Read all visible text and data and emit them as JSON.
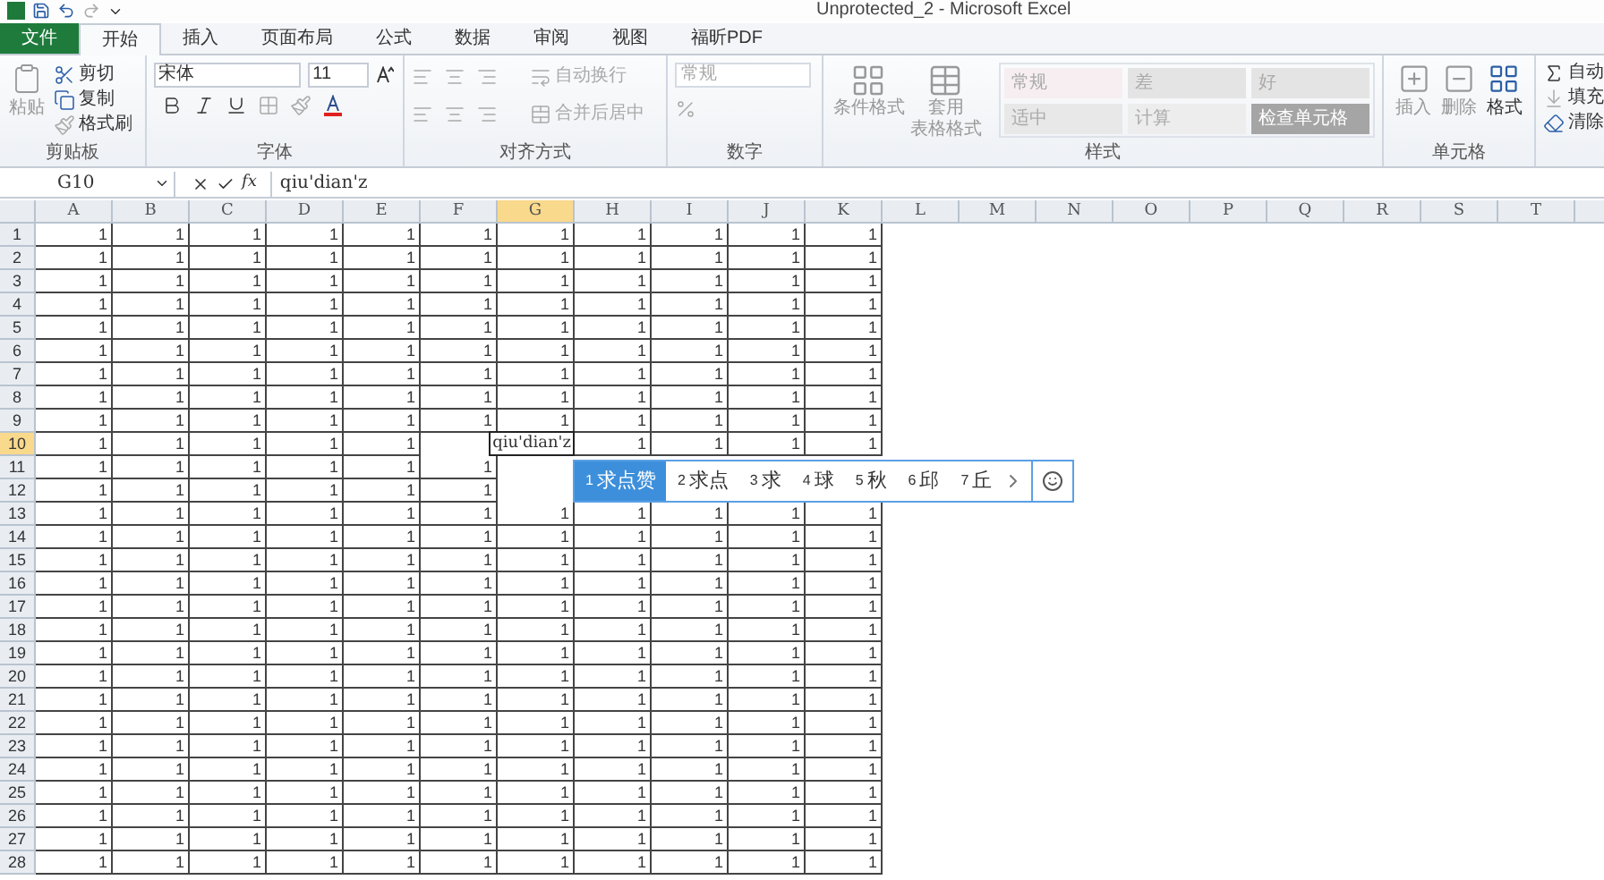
{
  "window": {
    "title": "Unprotected_2 - Microsoft Excel"
  },
  "tabs": [
    {
      "label": "文件",
      "kind": "file",
      "selected": false
    },
    {
      "label": "开始",
      "kind": "tab",
      "selected": true
    },
    {
      "label": "插入",
      "kind": "tab",
      "selected": false
    },
    {
      "label": "页面布局",
      "kind": "tab",
      "selected": false
    },
    {
      "label": "公式",
      "kind": "tab",
      "selected": false
    },
    {
      "label": "数据",
      "kind": "tab",
      "selected": false
    },
    {
      "label": "审阅",
      "kind": "tab",
      "selected": false
    },
    {
      "label": "视图",
      "kind": "tab",
      "selected": false
    },
    {
      "label": "福昕PDF",
      "kind": "tab",
      "selected": false
    }
  ],
  "ribbon": {
    "clipboard": {
      "label": "剪贴板",
      "paste": "粘贴",
      "items": [
        "剪切",
        "复制",
        "格式刷"
      ]
    },
    "font": {
      "label": "字体",
      "font_name": "宋体",
      "font_size": "11"
    },
    "alignment": {
      "label": "对齐方式",
      "wrap": "自动换行",
      "merge": "合并后居中"
    },
    "number": {
      "label": "数字",
      "format": "常规"
    },
    "styles": {
      "label": "样式",
      "buttons": [
        [
          "条件格式"
        ],
        [
          "套用",
          "表格格式"
        ]
      ],
      "cell_styles": [
        {
          "label": "常规",
          "color": "#f6eef0"
        },
        {
          "label": "差",
          "color": "#e4e4e4"
        },
        {
          "label": "好",
          "color": "#e4e4e4"
        },
        {
          "label": "适中",
          "color": "#e8e8e8"
        },
        {
          "label": "计算",
          "color": "#ededed"
        },
        {
          "label": "检查单元格",
          "color": "#a5a5a5"
        }
      ]
    },
    "cells": {
      "label": "单元格",
      "buttons": [
        "插入",
        "删除",
        "格式"
      ]
    },
    "editing": {
      "items": [
        "自动",
        "填充",
        "清除"
      ]
    }
  },
  "formula_bar": {
    "name_box": "G10",
    "function_label": "fx",
    "formula": "qiu'dian'z"
  },
  "sheet": {
    "columns": [
      {
        "label": "A",
        "selected": false
      },
      {
        "label": "B",
        "selected": false
      },
      {
        "label": "C",
        "selected": false
      },
      {
        "label": "D",
        "selected": false
      },
      {
        "label": "E",
        "selected": false
      },
      {
        "label": "F",
        "selected": false
      },
      {
        "label": "G",
        "selected": true
      },
      {
        "label": "H",
        "selected": false
      },
      {
        "label": "I",
        "selected": false
      },
      {
        "label": "J",
        "selected": false
      },
      {
        "label": "K",
        "selected": false
      },
      {
        "label": "L",
        "selected": false
      },
      {
        "label": "M",
        "selected": false
      },
      {
        "label": "N",
        "selected": false
      },
      {
        "label": "O",
        "selected": false
      },
      {
        "label": "P",
        "selected": false
      },
      {
        "label": "Q",
        "selected": false
      },
      {
        "label": "R",
        "selected": false
      },
      {
        "label": "S",
        "selected": false
      },
      {
        "label": "T",
        "selected": false
      }
    ],
    "rows": [
      {
        "label": "1",
        "selected": false,
        "cells": [
          "1",
          "1",
          "1",
          "1",
          "1",
          "1",
          "1",
          "1",
          "1",
          "1",
          "1"
        ]
      },
      {
        "label": "2",
        "selected": false,
        "cells": [
          "1",
          "1",
          "1",
          "1",
          "1",
          "1",
          "1",
          "1",
          "1",
          "1",
          "1"
        ]
      },
      {
        "label": "3",
        "selected": false,
        "cells": [
          "1",
          "1",
          "1",
          "1",
          "1",
          "1",
          "1",
          "1",
          "1",
          "1",
          "1"
        ]
      },
      {
        "label": "4",
        "selected": false,
        "cells": [
          "1",
          "1",
          "1",
          "1",
          "1",
          "1",
          "1",
          "1",
          "1",
          "1",
          "1"
        ]
      },
      {
        "label": "5",
        "selected": false,
        "cells": [
          "1",
          "1",
          "1",
          "1",
          "1",
          "1",
          "1",
          "1",
          "1",
          "1",
          "1"
        ]
      },
      {
        "label": "6",
        "selected": false,
        "cells": [
          "1",
          "1",
          "1",
          "1",
          "1",
          "1",
          "1",
          "1",
          "1",
          "1",
          "1"
        ]
      },
      {
        "label": "7",
        "selected": false,
        "cells": [
          "1",
          "1",
          "1",
          "1",
          "1",
          "1",
          "1",
          "1",
          "1",
          "1",
          "1"
        ]
      },
      {
        "label": "8",
        "selected": false,
        "cells": [
          "1",
          "1",
          "1",
          "1",
          "1",
          "1",
          "1",
          "1",
          "1",
          "1",
          "1"
        ]
      },
      {
        "label": "9",
        "selected": false,
        "cells": [
          "1",
          "1",
          "1",
          "1",
          "1",
          "1",
          "1",
          "1",
          "1",
          "1",
          "1"
        ]
      },
      {
        "label": "10",
        "selected": true,
        "cells": [
          "1",
          "1",
          "1",
          "1",
          "1",
          null,
          "qiu'dian'z",
          "1",
          "1",
          "1",
          "1"
        ]
      },
      {
        "label": "11",
        "selected": false,
        "cells": [
          "1",
          "1",
          "1",
          "1",
          "1",
          "1",
          null,
          null,
          null,
          null,
          null
        ]
      },
      {
        "label": "12",
        "selected": false,
        "cells": [
          "1",
          "1",
          "1",
          "1",
          "1",
          "1",
          null,
          null,
          null,
          null,
          null
        ]
      },
      {
        "label": "13",
        "selected": false,
        "cells": [
          "1",
          "1",
          "1",
          "1",
          "1",
          "1",
          "1",
          "1",
          "1",
          "1",
          "1"
        ]
      },
      {
        "label": "14",
        "selected": false,
        "cells": [
          "1",
          "1",
          "1",
          "1",
          "1",
          "1",
          "1",
          "1",
          "1",
          "1",
          "1"
        ]
      },
      {
        "label": "15",
        "selected": false,
        "cells": [
          "1",
          "1",
          "1",
          "1",
          "1",
          "1",
          "1",
          "1",
          "1",
          "1",
          "1"
        ]
      },
      {
        "label": "16",
        "selected": false,
        "cells": [
          "1",
          "1",
          "1",
          "1",
          "1",
          "1",
          "1",
          "1",
          "1",
          "1",
          "1"
        ]
      },
      {
        "label": "17",
        "selected": false,
        "cells": [
          "1",
          "1",
          "1",
          "1",
          "1",
          "1",
          "1",
          "1",
          "1",
          "1",
          "1"
        ]
      },
      {
        "label": "18",
        "selected": false,
        "cells": [
          "1",
          "1",
          "1",
          "1",
          "1",
          "1",
          "1",
          "1",
          "1",
          "1",
          "1"
        ]
      },
      {
        "label": "19",
        "selected": false,
        "cells": [
          "1",
          "1",
          "1",
          "1",
          "1",
          "1",
          "1",
          "1",
          "1",
          "1",
          "1"
        ]
      },
      {
        "label": "20",
        "selected": false,
        "cells": [
          "1",
          "1",
          "1",
          "1",
          "1",
          "1",
          "1",
          "1",
          "1",
          "1",
          "1"
        ]
      },
      {
        "label": "21",
        "selected": false,
        "cells": [
          "1",
          "1",
          "1",
          "1",
          "1",
          "1",
          "1",
          "1",
          "1",
          "1",
          "1"
        ]
      },
      {
        "label": "22",
        "selected": false,
        "cells": [
          "1",
          "1",
          "1",
          "1",
          "1",
          "1",
          "1",
          "1",
          "1",
          "1",
          "1"
        ]
      },
      {
        "label": "23",
        "selected": false,
        "cells": [
          "1",
          "1",
          "1",
          "1",
          "1",
          "1",
          "1",
          "1",
          "1",
          "1",
          "1"
        ]
      },
      {
        "label": "24",
        "selected": false,
        "cells": [
          "1",
          "1",
          "1",
          "1",
          "1",
          "1",
          "1",
          "1",
          "1",
          "1",
          "1"
        ]
      },
      {
        "label": "25",
        "selected": false,
        "cells": [
          "1",
          "1",
          "1",
          "1",
          "1",
          "1",
          "1",
          "1",
          "1",
          "1",
          "1"
        ]
      },
      {
        "label": "26",
        "selected": false,
        "cells": [
          "1",
          "1",
          "1",
          "1",
          "1",
          "1",
          "1",
          "1",
          "1",
          "1",
          "1"
        ]
      },
      {
        "label": "27",
        "selected": false,
        "cells": [
          "1",
          "1",
          "1",
          "1",
          "1",
          "1",
          "1",
          "1",
          "1",
          "1",
          "1"
        ]
      },
      {
        "label": "28",
        "selected": false,
        "cells": [
          "1",
          "1",
          "1",
          "1",
          "1",
          "1",
          "1",
          "1",
          "1",
          "1",
          "1"
        ]
      }
    ]
  },
  "ime": {
    "candidates": [
      {
        "number": "1",
        "text": "求点赞",
        "selected": true
      },
      {
        "number": "2",
        "text": "求点",
        "selected": false
      },
      {
        "number": "3",
        "text": "求",
        "selected": false
      },
      {
        "number": "4",
        "text": "球",
        "selected": false
      },
      {
        "number": "5",
        "text": "秋",
        "selected": false
      },
      {
        "number": "6",
        "text": "邱",
        "selected": false
      },
      {
        "number": "7",
        "text": "丘",
        "selected": false
      }
    ]
  }
}
